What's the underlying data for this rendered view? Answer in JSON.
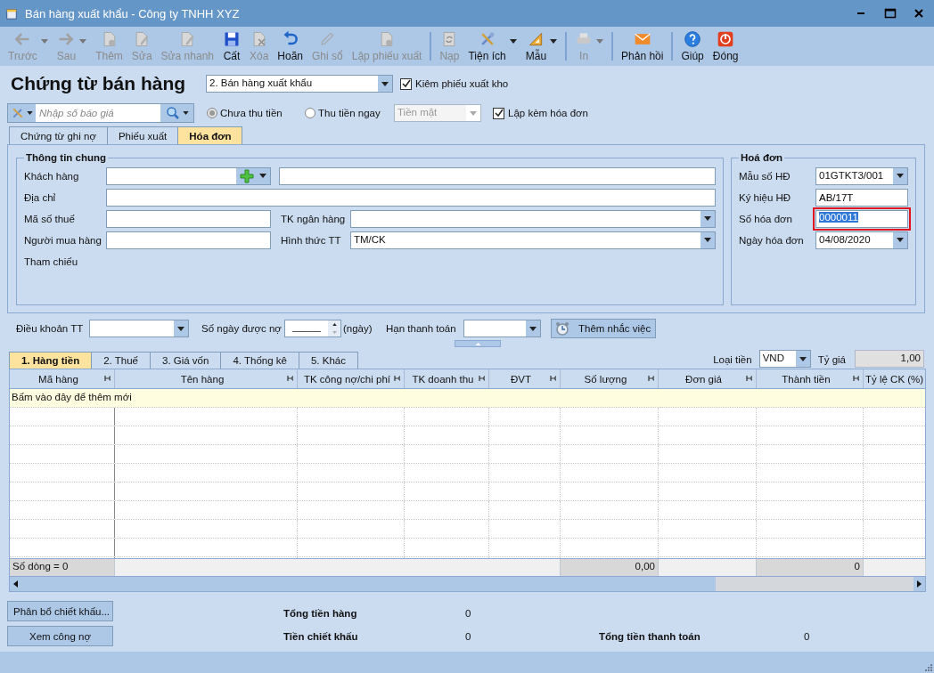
{
  "window": {
    "title": "Bán hàng xuất khẩu - Công ty TNHH XYZ"
  },
  "toolbar": [
    {
      "kind": "back",
      "label": "Trước",
      "disabled": true,
      "dropdown": true
    },
    {
      "kind": "forward",
      "label": "Sau",
      "disabled": true,
      "dropdown": true
    },
    {
      "kind": "add",
      "label": "Thêm",
      "disabled": true,
      "dropdown": false
    },
    {
      "kind": "edit",
      "label": "Sửa",
      "disabled": true,
      "dropdown": false
    },
    {
      "kind": "edit",
      "label": "Sửa nhanh",
      "disabled": true,
      "dropdown": false
    },
    {
      "kind": "save",
      "label": "Cất",
      "disabled": false,
      "dropdown": false
    },
    {
      "kind": "delete",
      "label": "Xóa",
      "disabled": true,
      "dropdown": false
    },
    {
      "kind": "undo",
      "label": "Hoãn",
      "disabled": false,
      "dropdown": false
    },
    {
      "kind": "post",
      "label": "Ghi sổ",
      "disabled": true,
      "dropdown": false
    },
    {
      "kind": "add",
      "label": "Lập phiếu xuất",
      "disabled": true,
      "dropdown": false
    },
    {
      "kind": "separator"
    },
    {
      "kind": "reload",
      "label": "Nạp",
      "disabled": true,
      "dropdown": false
    },
    {
      "kind": "tools",
      "label": "Tiện ích",
      "disabled": false,
      "dropdown": true
    },
    {
      "kind": "template",
      "label": "Mẫu",
      "disabled": false,
      "dropdown": true
    },
    {
      "kind": "separator"
    },
    {
      "kind": "print",
      "label": "In",
      "disabled": true,
      "dropdown": true
    },
    {
      "kind": "separator"
    },
    {
      "kind": "feedback",
      "label": "Phản hồi",
      "disabled": false,
      "dropdown": false
    },
    {
      "kind": "separator"
    },
    {
      "kind": "help",
      "label": "Giúp",
      "disabled": false,
      "dropdown": false
    },
    {
      "kind": "close",
      "label": "Đóng",
      "disabled": false,
      "dropdown": false
    }
  ],
  "header": {
    "title": "Chứng từ bán hàng",
    "voucher_type": "2. Bán hàng xuất khẩu",
    "export_slip": {
      "label": "Kiêm phiếu xuất kho",
      "checked": true
    }
  },
  "quote_search": {
    "placeholder": "Nhập số báo giá"
  },
  "payment": [
    {
      "label": "Chưa thu tiền",
      "selected": true,
      "disabled": true
    },
    {
      "label": "Thu tiền ngay",
      "selected": false,
      "disabled": false
    }
  ],
  "payment_method": {
    "value": "Tiền mặt",
    "disabled": true
  },
  "with_invoice": {
    "label": "Lập kèm hóa đơn",
    "checked": true
  },
  "doc_tabs": [
    {
      "label": "Chứng từ ghi nợ",
      "selected": false
    },
    {
      "label": "Phiếu xuất",
      "selected": false
    },
    {
      "label": "Hóa đơn",
      "selected": true
    }
  ],
  "general_info": {
    "title": "Thông tin chung",
    "customer_label": "Khách hàng",
    "address_label": "Địa chỉ",
    "tax_code_label": "Mã số thuế",
    "bank_account_label": "TK ngân hàng",
    "buyer_label": "Người mua hàng",
    "payment_form_label": "Hình thức TT",
    "payment_form": "TM/CK",
    "reference_label": "Tham chiếu"
  },
  "invoice": {
    "title": "Hoá đơn",
    "template_label": "Mẫu số HĐ",
    "template": "01GTKT3/001",
    "series_label": "Ký hiệu HĐ",
    "series": "AB/17T",
    "number_label": "Số hóa đơn",
    "number": "0000011",
    "number_highlighted": true,
    "date_label": "Ngày hóa đơn",
    "date": "04/08/2020"
  },
  "terms": {
    "label": "Điều khoản TT",
    "days_label": "Số ngày được nợ",
    "days": "_____",
    "days_unit": "(ngày)",
    "due_label": "Hạn thanh toán",
    "reminder_button": "Thêm nhắc việc"
  },
  "detail_tabs": [
    {
      "label": "1. Hàng tiền",
      "selected": true
    },
    {
      "label": "2. Thuế",
      "selected": false
    },
    {
      "label": "3. Giá vốn",
      "selected": false
    },
    {
      "label": "4. Thống kê",
      "selected": false
    },
    {
      "label": "5. Khác",
      "selected": false
    }
  ],
  "currency": {
    "label": "Loại tiền",
    "value": "VND",
    "rate_label": "Tỷ giá",
    "rate": "1,00"
  },
  "grid": {
    "columns": [
      "Mã hàng",
      "Tên hàng",
      "TK công nợ/chi phí",
      "TK doanh thu",
      "ĐVT",
      "Số lượng",
      "Đơn giá",
      "Thành tiền",
      "Tỷ lệ CK (%)"
    ],
    "new_row_hint": "Bấm vào đây để thêm mới",
    "footer": {
      "row_count": "Số dòng = 0",
      "quantity_total": "0,00",
      "amount_total": "0"
    }
  },
  "buttons": [
    "Phân bổ chiết khấu...",
    "Xem công nợ"
  ],
  "totals": {
    "goods_label": "Tổng tiền hàng",
    "goods": "0",
    "discount_label": "Tiền chiết khấu",
    "discount": "0",
    "payment_label": "Tổng tiền thanh toán",
    "payment": "0"
  }
}
